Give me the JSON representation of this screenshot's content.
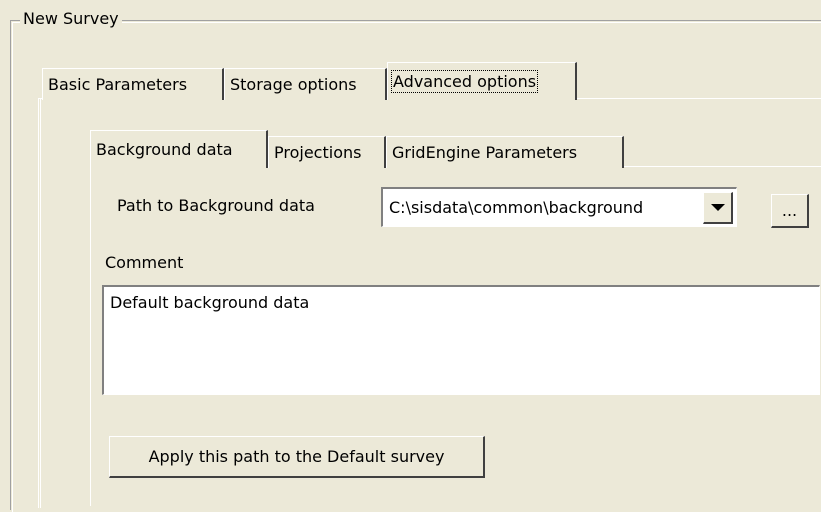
{
  "group": {
    "title": "New Survey"
  },
  "tabs": [
    {
      "label": "Basic Parameters"
    },
    {
      "label": "Storage options"
    },
    {
      "label": "Advanced options"
    }
  ],
  "subtabs": [
    {
      "label": "Background data"
    },
    {
      "label": "Projections"
    },
    {
      "label": "GridEngine Parameters"
    }
  ],
  "background": {
    "path_label": "Path to Background data",
    "path_value": "C:\\sisdata\\common\\background",
    "browse_label": "...",
    "comment_label": "Comment",
    "comment_value": "Default background data",
    "apply_button": "Apply this path to the Default survey"
  }
}
